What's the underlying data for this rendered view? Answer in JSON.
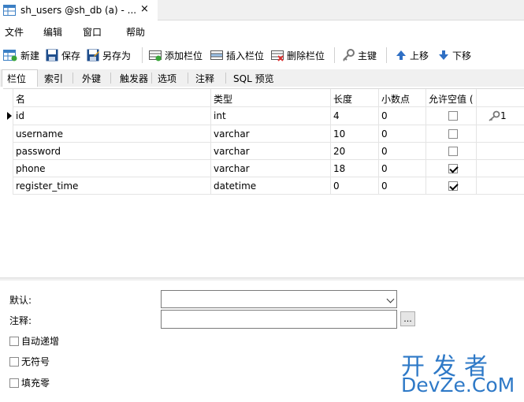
{
  "window": {
    "tab_title": "sh_users @sh_db (a) - ...",
    "close_glyph": "×"
  },
  "menu": [
    "文件",
    "编辑",
    "窗口",
    "帮助"
  ],
  "toolbar": {
    "new": "新建",
    "save": "保存",
    "save_as": "另存为",
    "add_field": "添加栏位",
    "insert_field": "插入栏位",
    "delete_field": "删除栏位",
    "primary_key": "主键",
    "move_up": "上移",
    "move_down": "下移"
  },
  "tabs": [
    "栏位",
    "索引",
    "外键",
    "触发器",
    "选项",
    "注释",
    "SQL 预览"
  ],
  "active_tab": "栏位",
  "grid": {
    "headers": [
      "名",
      "类型",
      "长度",
      "小数点",
      "允许空值 ("
    ],
    "rows": [
      {
        "name": "id",
        "type": "int",
        "length": "4",
        "decimals": "0",
        "nullable": false,
        "key": "1"
      },
      {
        "name": "username",
        "type": "varchar",
        "length": "10",
        "decimals": "0",
        "nullable": false,
        "key": ""
      },
      {
        "name": "password",
        "type": "varchar",
        "length": "20",
        "decimals": "0",
        "nullable": false,
        "key": ""
      },
      {
        "name": "phone",
        "type": "varchar",
        "length": "18",
        "decimals": "0",
        "nullable": true,
        "key": ""
      },
      {
        "name": "register_time",
        "type": "datetime",
        "length": "0",
        "decimals": "0",
        "nullable": true,
        "key": ""
      }
    ]
  },
  "properties": {
    "default_label": "默认:",
    "comment_label": "注释:",
    "ellipsis": "...",
    "auto_increment": "自动递增",
    "unsigned": "无符号",
    "zerofill": "填充零"
  },
  "watermark": {
    "line1": "开发者",
    "line2": "DevZe.CoM"
  },
  "colors": {
    "watermark": "#2e79c7",
    "save_icon": "#1f4e8c",
    "arrow_icon": "#2f6fc4"
  }
}
